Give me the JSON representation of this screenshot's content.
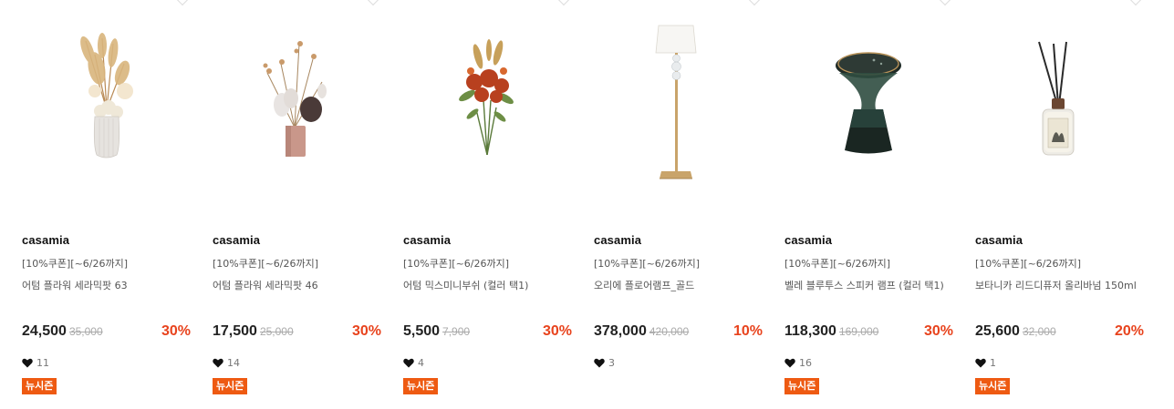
{
  "products": [
    {
      "brand": "casamia",
      "coupon": "[10%쿠폰][~6/26까지]",
      "name": "어텀 플라워 세라믹팟 63",
      "price": "24,500",
      "original_price": "35,000",
      "discount": "30%",
      "likes": "11",
      "badge": "뉴시즌",
      "image_icon": "dried-flower-vase-image"
    },
    {
      "brand": "casamia",
      "coupon": "[10%쿠폰][~6/26까지]",
      "name": "어텀 플라워 세라믹팟 46",
      "price": "17,500",
      "original_price": "25,000",
      "discount": "30%",
      "likes": "14",
      "badge": "뉴시즌",
      "image_icon": "flower-pink-pot-image"
    },
    {
      "brand": "casamia",
      "coupon": "[10%쿠폰][~6/26까지]",
      "name": "어텀 믹스미니부쉬 (컬러 택1)",
      "price": "5,500",
      "original_price": "7,900",
      "discount": "30%",
      "likes": "4",
      "badge": "뉴시즌",
      "image_icon": "mini-bush-bouquet-image"
    },
    {
      "brand": "casamia",
      "coupon": "[10%쿠폰][~6/26까지]",
      "name": "오리에 플로어램프_골드",
      "price": "378,000",
      "original_price": "420,000",
      "discount": "10%",
      "likes": "3",
      "badge": "",
      "image_icon": "floor-lamp-image"
    },
    {
      "brand": "casamia",
      "coupon": "[10%쿠폰][~6/26까지]",
      "name": "벨레 블루투스 스피커 램프 (컬러 택1)",
      "price": "118,300",
      "original_price": "169,000",
      "discount": "30%",
      "likes": "16",
      "badge": "뉴시즌",
      "image_icon": "speaker-lamp-image"
    },
    {
      "brand": "casamia",
      "coupon": "[10%쿠폰][~6/26까지]",
      "name": "보타니카 리드디퓨저 올리바넘 150ml",
      "price": "25,600",
      "original_price": "32,000",
      "discount": "20%",
      "likes": "1",
      "badge": "뉴시즌",
      "image_icon": "reed-diffuser-image"
    }
  ],
  "colors": {
    "discount": "#e8431d",
    "badge_bg": "#ee5a12",
    "original_price": "#aaaaaa"
  }
}
